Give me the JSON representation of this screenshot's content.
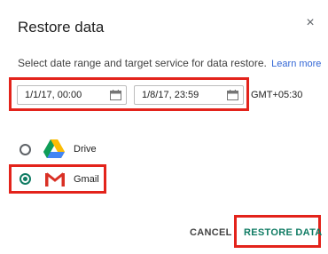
{
  "dialog": {
    "title": "Restore data",
    "close_glyph": "×",
    "description": "Select date range and target service for data restore.",
    "learn_more": "Learn more"
  },
  "date_range": {
    "start": "1/1/17, 00:00",
    "end": "1/8/17, 23:59",
    "timezone": "GMT+05:30",
    "icon": "calendar-icon"
  },
  "services": [
    {
      "label": "Drive",
      "icon": "google-drive-icon",
      "selected": false
    },
    {
      "label": "Gmail",
      "icon": "gmail-icon",
      "selected": true
    }
  ],
  "actions": {
    "cancel": "CANCEL",
    "restore": "RESTORE DATA"
  },
  "colors": {
    "highlight": "#e3231b",
    "accent": "#0f7b63",
    "link": "#3367d6"
  }
}
